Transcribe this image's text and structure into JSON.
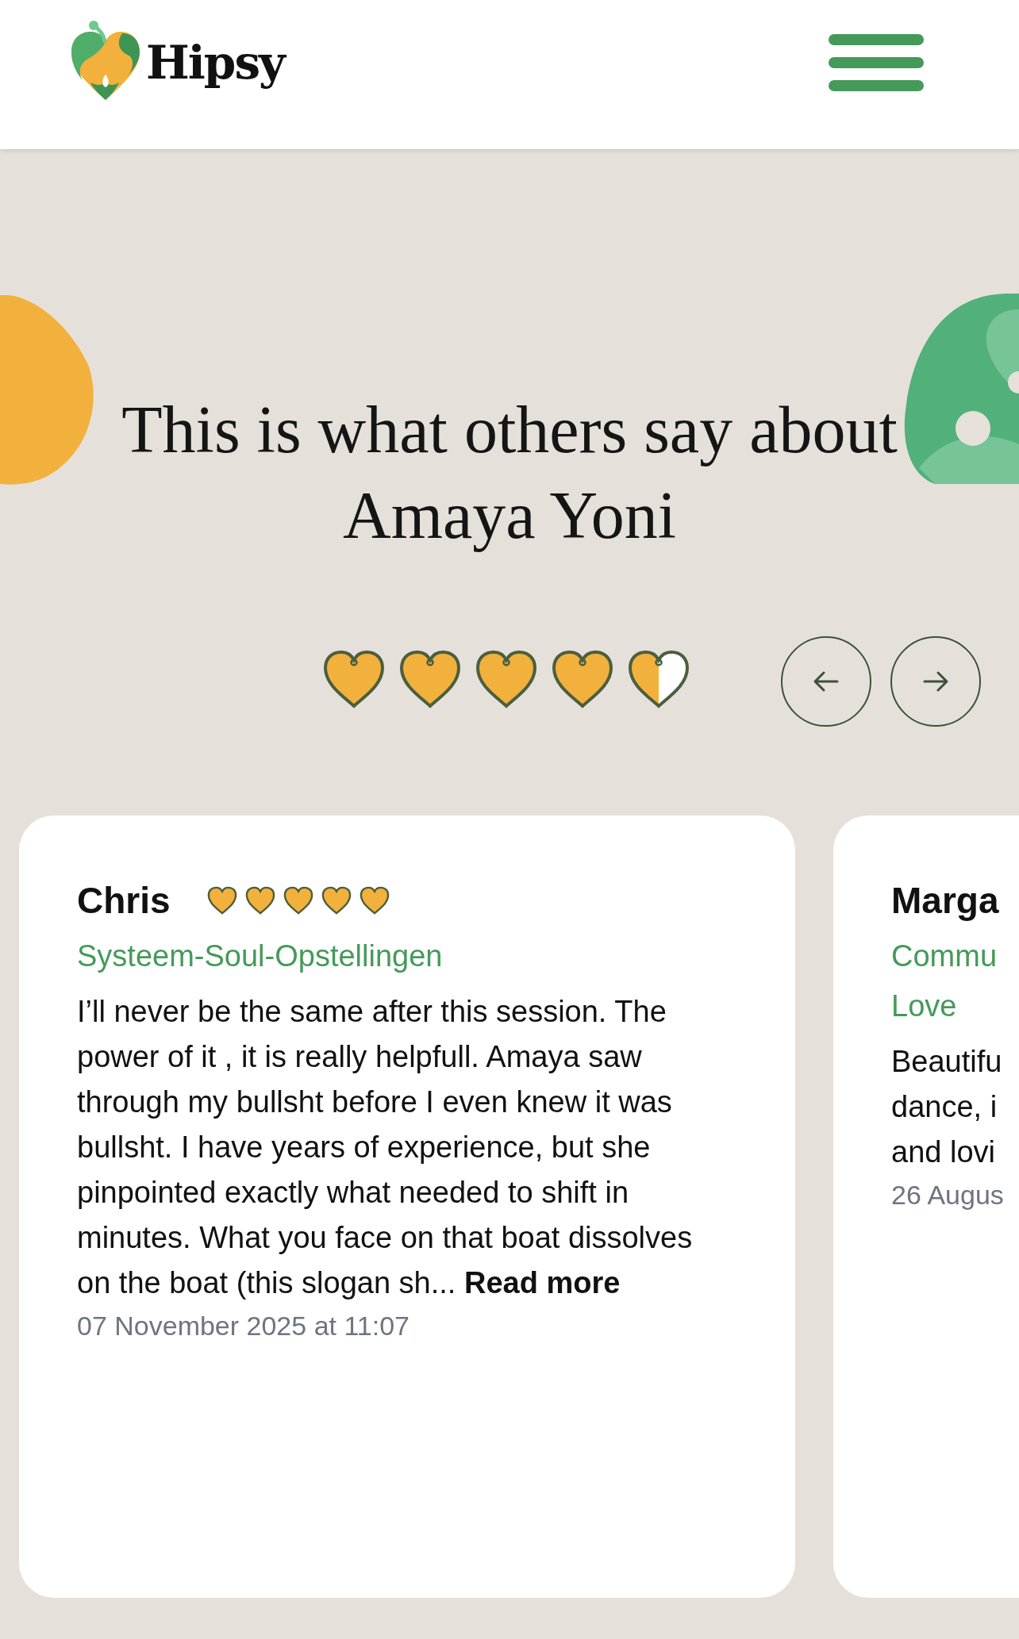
{
  "header": {
    "logo_text": "Hipsy"
  },
  "hero": {
    "title_lines": [
      "This is what others say about",
      "Amaya Yoni"
    ]
  },
  "rating": {
    "stars": 4.5
  },
  "reviews": [
    {
      "name": "Chris",
      "stars": 5,
      "tags": [
        "Systeem-Soul-Opstellingen"
      ],
      "body": "I’ll never be the same after this session. The power of it , it is really helpfull. Amaya saw through my bullsht before I even knew it was bullsht. I have years of experience, but she pinpointed exactly what needed to shift in minutes. What you face on that boat dissolves on the boat (this slogan sh...",
      "read_more": "Read more",
      "date": "07 November 2025 at 11:07"
    },
    {
      "name": "Marga",
      "tags": [
        "Commu",
        "Love"
      ],
      "body_lines": [
        "Beautifu",
        "dance, i",
        "and lovi"
      ],
      "date": "26 Augus"
    }
  ]
}
